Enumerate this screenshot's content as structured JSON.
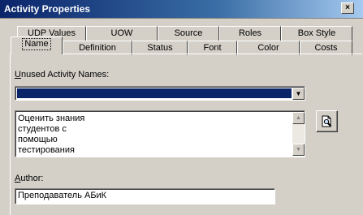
{
  "window": {
    "title": "Activity Properties",
    "close_glyph": "×"
  },
  "tabs_back": [
    {
      "label": "UDP Values"
    },
    {
      "label": "UOW"
    },
    {
      "label": "Source"
    },
    {
      "label": "Roles"
    },
    {
      "label": "Box Style"
    }
  ],
  "tabs_front": [
    {
      "label": "Name",
      "active": true
    },
    {
      "label": "Definition"
    },
    {
      "label": "Status"
    },
    {
      "label": "Font"
    },
    {
      "label": "Color"
    },
    {
      "label": "Costs"
    }
  ],
  "unused_names": {
    "label_prefix": "U",
    "label_rest": "nused Activity Names:",
    "selected_value": ""
  },
  "name_text": {
    "lines": [
      "Оценить знания",
      "студентов с",
      "помощью",
      "тестирования"
    ]
  },
  "search_button": {
    "icon": "search-document-icon"
  },
  "author": {
    "label_prefix": "A",
    "label_rest": "uthor:",
    "value": "Преподаватель АБиК"
  },
  "colors": {
    "titlebar_start": "#0a246a",
    "selection": "#0a246a",
    "face": "#d4d0c8"
  }
}
